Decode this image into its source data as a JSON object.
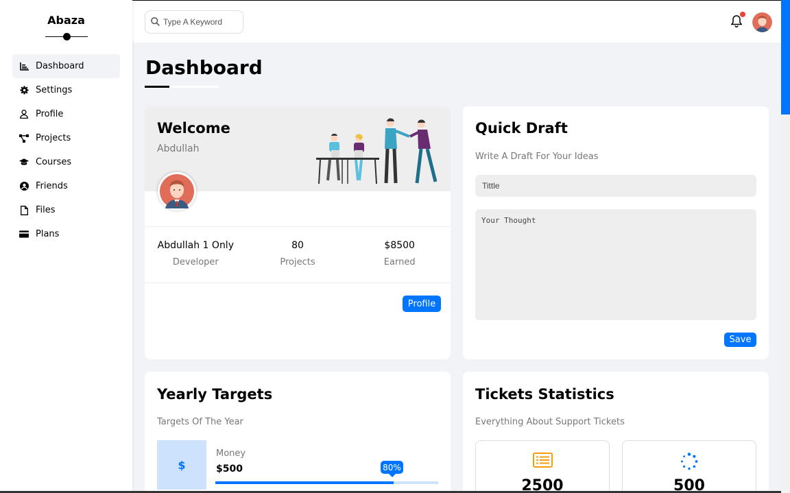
{
  "brand": {
    "name": "Abaza"
  },
  "sidebar": {
    "items": [
      {
        "label": "Dashboard",
        "icon": "chart-icon",
        "active": true
      },
      {
        "label": "Settings",
        "icon": "gear-icon"
      },
      {
        "label": "Profile",
        "icon": "user-icon"
      },
      {
        "label": "Projects",
        "icon": "diagram-icon"
      },
      {
        "label": "Courses",
        "icon": "graduation-cap-icon"
      },
      {
        "label": "Friends",
        "icon": "user-circle-icon"
      },
      {
        "label": "Files",
        "icon": "file-icon"
      },
      {
        "label": "Plans",
        "icon": "credit-card-icon"
      }
    ]
  },
  "header": {
    "search_placeholder": "Type A Keyword",
    "notification_dot_color": "#f44336"
  },
  "page": {
    "title": "Dashboard"
  },
  "welcome": {
    "title": "Welcome",
    "name": "Abdullah",
    "stats": [
      {
        "value": "Abdullah 1 Only",
        "label": "Developer"
      },
      {
        "value": "80",
        "label": "Projects"
      },
      {
        "value": "$8500",
        "label": "Earned"
      }
    ],
    "button_label": "Profile"
  },
  "draft": {
    "title": "Quick Draft",
    "subtitle": "Write A Draft For Your Ideas",
    "title_placeholder": "Tittle",
    "body_placeholder": "Your Thought",
    "save_label": "Save"
  },
  "targets": {
    "title": "Yearly Targets",
    "subtitle": "Targets Of The Year",
    "items": [
      {
        "symbol": "$",
        "name": "Money",
        "amount": "$500",
        "progress_label": "80%",
        "progress": 0.8
      }
    ]
  },
  "tickets": {
    "title": "Tickets Statistics",
    "subtitle": "Everything About Support Tickets",
    "items": [
      {
        "value": "2500",
        "icon": "list-icon",
        "color": "#f59e0b"
      },
      {
        "value": "500",
        "icon": "spinner-icon",
        "color": "#0075ff"
      }
    ]
  },
  "colors": {
    "accent": "#0075ff",
    "background": "#f1f3f7"
  }
}
